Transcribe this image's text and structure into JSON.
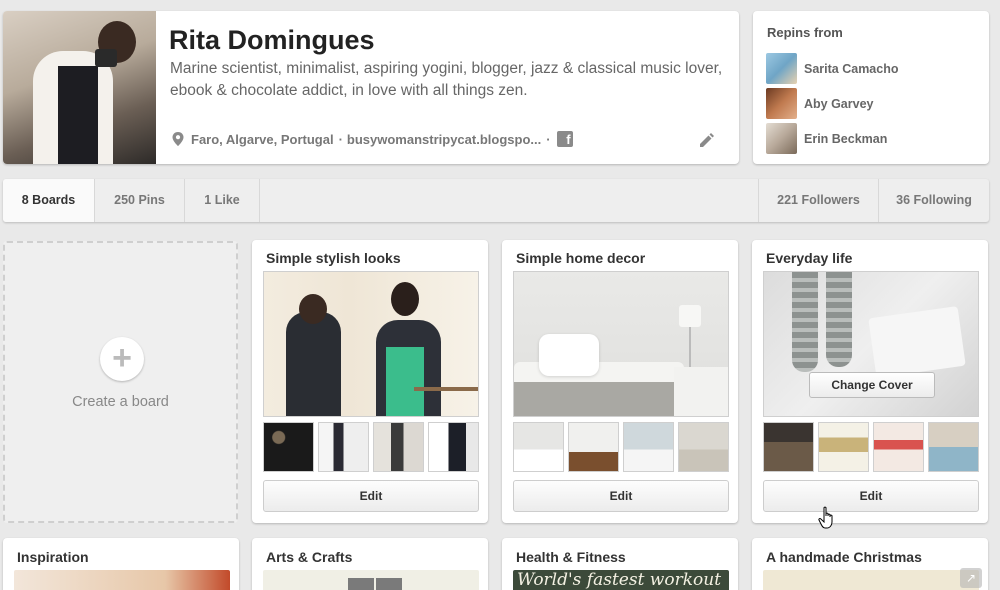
{
  "profile": {
    "name": "Rita Domingues",
    "bio": "Marine scientist, minimalist, aspiring yogini, blogger, jazz & classical music lover, ebook & chocolate addict, in love with all things zen.",
    "location": "Faro, Algarve, Portugal",
    "separator": "·",
    "website": "busywomanstripycat.blogspo...",
    "separator2": "·",
    "facebook_glyph": "f"
  },
  "repins": {
    "title": "Repins from",
    "users": [
      {
        "name": "Sarita Camacho",
        "color": "#6fa5c6"
      },
      {
        "name": "Aby Garvey",
        "color": "#c07a4f"
      },
      {
        "name": "Erin Beckman",
        "color": "#b7a899"
      }
    ]
  },
  "tabs": {
    "boards": "8 Boards",
    "pins": "250 Pins",
    "likes": "1 Like",
    "followers": "221 Followers",
    "following": "36 Following"
  },
  "create_board": {
    "plus": "+",
    "label": "Create a board"
  },
  "boards": [
    {
      "title": "Simple stylish looks",
      "edit_label": "Edit"
    },
    {
      "title": "Simple home decor",
      "edit_label": "Edit"
    },
    {
      "title": "Everyday life",
      "edit_label": "Edit",
      "change_cover_label": "Change Cover"
    }
  ],
  "boards_row2": [
    {
      "title": "Inspiration"
    },
    {
      "title": "Arts & Crafts"
    },
    {
      "title": "Health & Fitness",
      "cover_text": "World's fastest workout"
    },
    {
      "title": "A handmade Christmas"
    }
  ],
  "colors": {
    "background": "#e9e9e9",
    "card": "#ffffff",
    "tab_bar": "#eeeeee",
    "text_dark": "#222222",
    "text_muted": "#777777"
  },
  "icons": [
    "location-pin-icon",
    "facebook-icon",
    "pencil-icon",
    "plus-icon",
    "hand-cursor-icon",
    "share-icon"
  ]
}
